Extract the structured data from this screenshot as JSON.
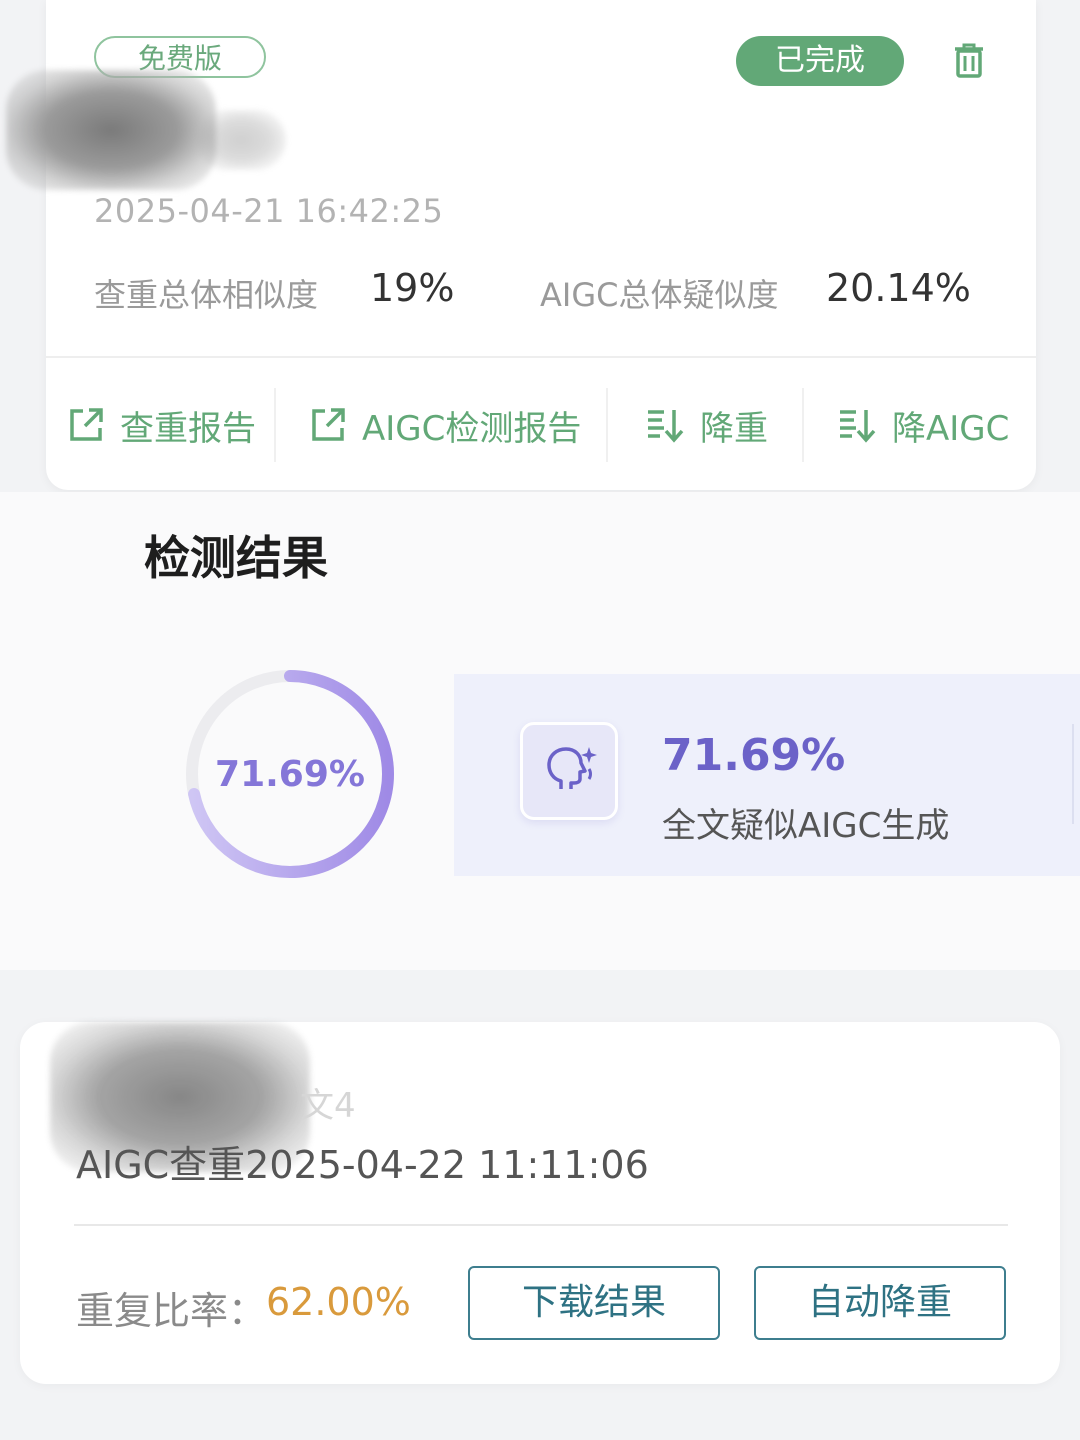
{
  "record1": {
    "edition_badge": "免费版",
    "status_badge": "已完成",
    "timestamp": "2025-04-21 16:42:25",
    "plagiarism_label": "查重总体相似度",
    "plagiarism_value": "19%",
    "aigc_label": "AIGC总体疑似度",
    "aigc_value": "20.14%",
    "actions": [
      {
        "label": "查重报告",
        "icon": "external-link-icon"
      },
      {
        "label": "AIGC检测报告",
        "icon": "external-link-icon"
      },
      {
        "label": "降重",
        "icon": "sort-down-icon"
      },
      {
        "label": "降AIGC",
        "icon": "sort-down-icon"
      }
    ]
  },
  "detection": {
    "title": "检测结果",
    "ring_value": "71.69%",
    "ring_fraction": 0.7169,
    "summary_pct": "71.69%",
    "summary_desc": "全文疑似AIGC生成"
  },
  "record2": {
    "title_fragment": "文4",
    "timestamp": "AIGC查重2025-04-22 11:11:06",
    "ratio_label": "重复比率：",
    "ratio_value": "62.00%",
    "download_button": "下载结果",
    "auto_reduce_button": "自动降重"
  },
  "colors": {
    "green": "#62a877",
    "purple": "#8476d8",
    "orange": "#d99a3c",
    "teal": "#2e7283"
  }
}
